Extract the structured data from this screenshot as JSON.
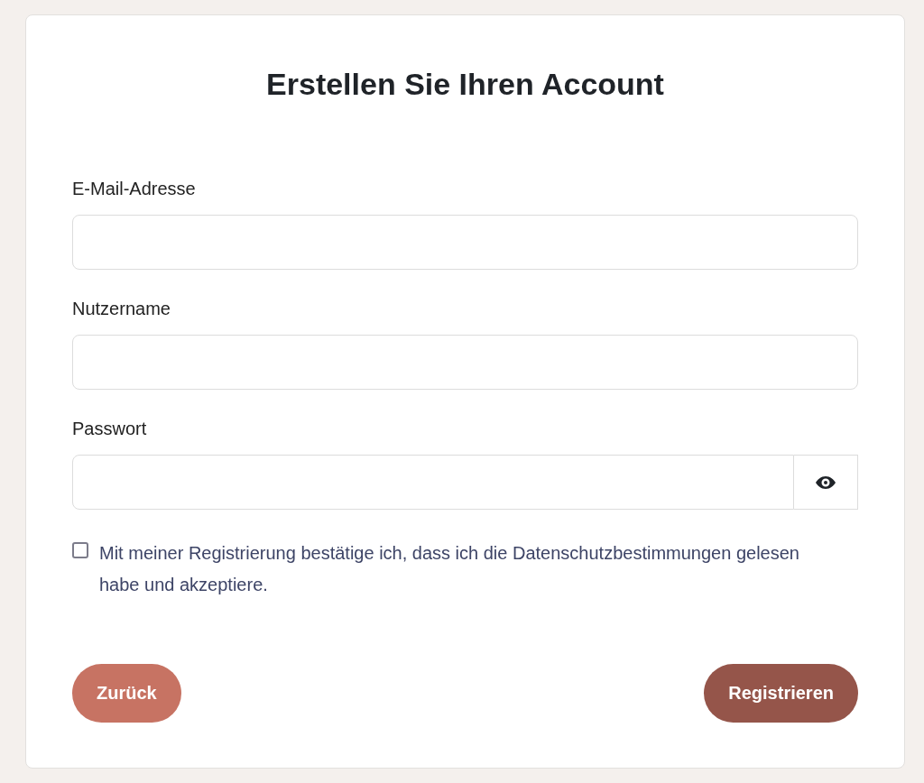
{
  "title": "Erstellen Sie Ihren Account",
  "fields": [
    {
      "label": "E-Mail-Adresse",
      "kind": "text"
    },
    {
      "label": "Nutzername",
      "kind": "text"
    },
    {
      "label": "Passwort",
      "kind": "password"
    }
  ],
  "consent": {
    "text": "Mit meiner Registrierung bestätige ich, dass ich die Datenschutzbestimmungen gelesen habe und akzeptiere.",
    "checked": false
  },
  "buttons": [
    {
      "label": "Zurück",
      "kind": "secondary"
    },
    {
      "label": "Registrieren",
      "kind": "primary"
    }
  ]
}
